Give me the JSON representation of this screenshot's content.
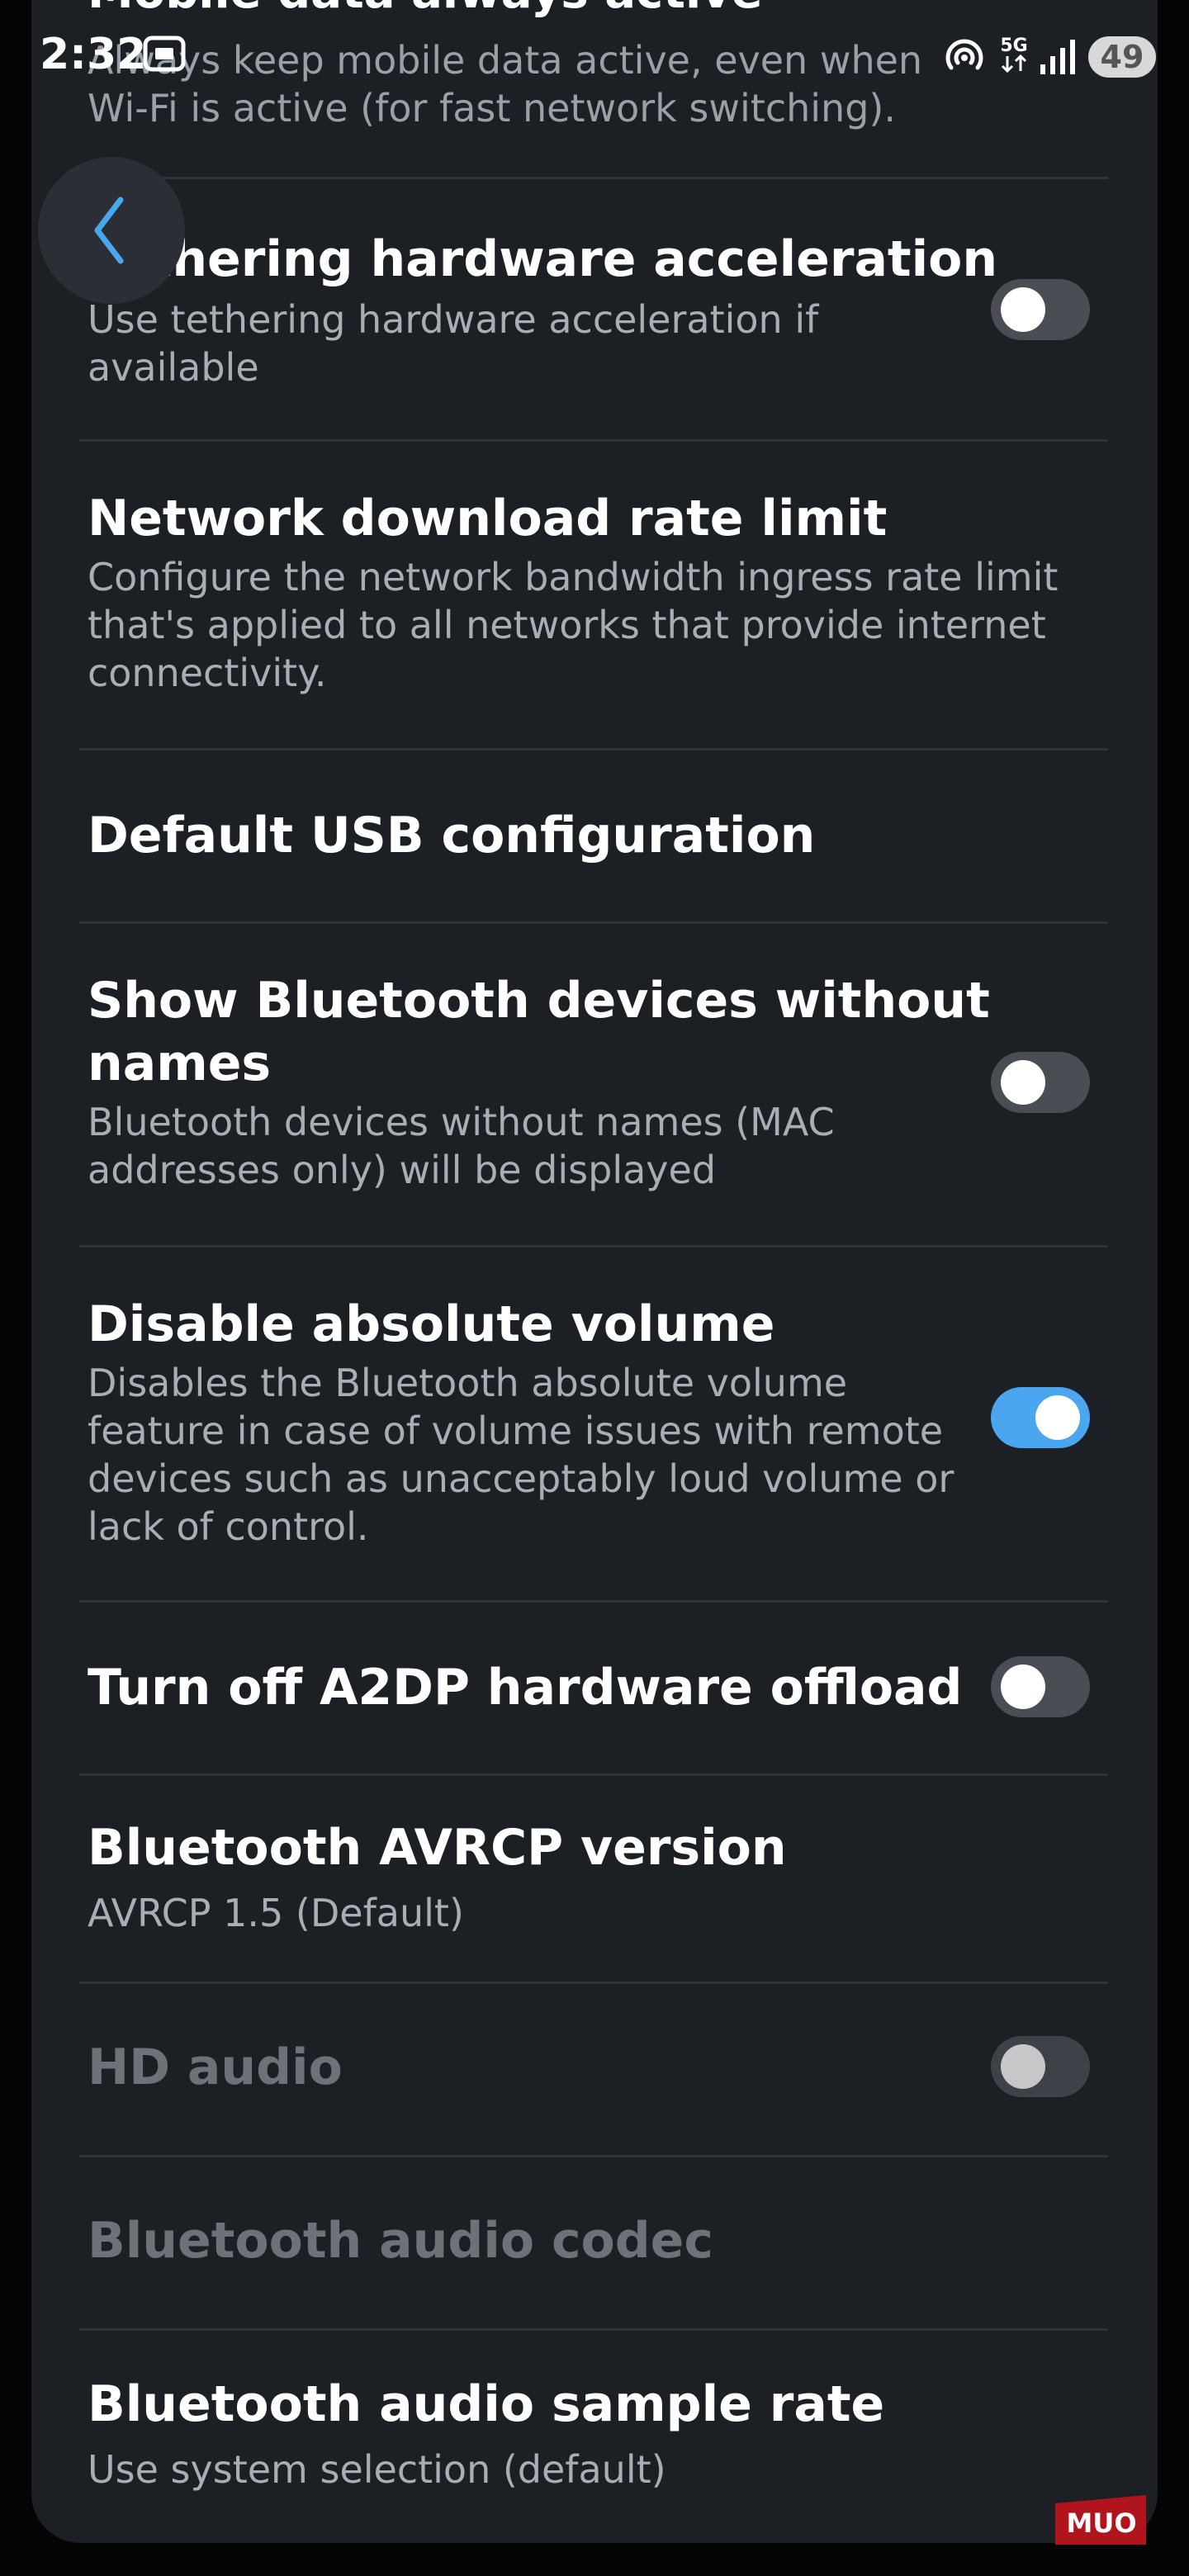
{
  "status_bar": {
    "time": "2:32",
    "battery": "49",
    "network_label": "5G",
    "icons": [
      "screenshot-icon",
      "hotspot-icon",
      "5g-icon",
      "signal-icon",
      "battery-icon"
    ]
  },
  "colors": {
    "background": "#1c1f24",
    "toggle_on": "#4aa6ef",
    "toggle_off": "#4a4d53",
    "disabled_text": "#6d7178"
  },
  "partial_item": {
    "title": "Mobile data always active",
    "subtitle_line1": "Always keep mobile data active, even when",
    "subtitle_line2": "Wi-Fi is active (for fast network switching)."
  },
  "settings": [
    {
      "id": "tethering",
      "title": "Tethering hardware acceleration",
      "subtitle_lines": [
        "Use tethering hardware acceleration if",
        "available"
      ],
      "toggle": "off"
    },
    {
      "id": "download_limit",
      "title": "Network download rate limit",
      "subtitle_lines": [
        "Configure the network bandwidth ingress rate limit",
        "that's applied to all networks that provide internet",
        "connectivity."
      ]
    },
    {
      "id": "usb_config",
      "title": "Default USB configuration"
    },
    {
      "id": "bt_no_names",
      "title_lines": [
        "Show Bluetooth devices without",
        "names"
      ],
      "subtitle_lines": [
        "Bluetooth devices without names (MAC",
        "addresses only) will be displayed"
      ],
      "toggle": "off"
    },
    {
      "id": "abs_volume",
      "title": "Disable absolute volume",
      "subtitle_lines": [
        "Disables the Bluetooth absolute volume",
        "feature in case of volume issues with remote",
        "devices such as unacceptably loud volume or",
        "lack of control."
      ],
      "toggle": "on"
    },
    {
      "id": "a2dp",
      "title": "Turn off A2DP hardware offload",
      "toggle": "off"
    },
    {
      "id": "avrcp",
      "title": "Bluetooth AVRCP version",
      "subtitle_lines": [
        "AVRCP 1.5 (Default)"
      ]
    },
    {
      "id": "hd_audio",
      "title": "HD audio",
      "toggle": "off",
      "disabled": true
    },
    {
      "id": "codec",
      "title": "Bluetooth audio codec",
      "disabled": true
    },
    {
      "id": "sample_rate",
      "title": "Bluetooth audio sample rate",
      "subtitle_lines": [
        "Use system selection (default)"
      ]
    }
  ],
  "watermark": "MUO"
}
